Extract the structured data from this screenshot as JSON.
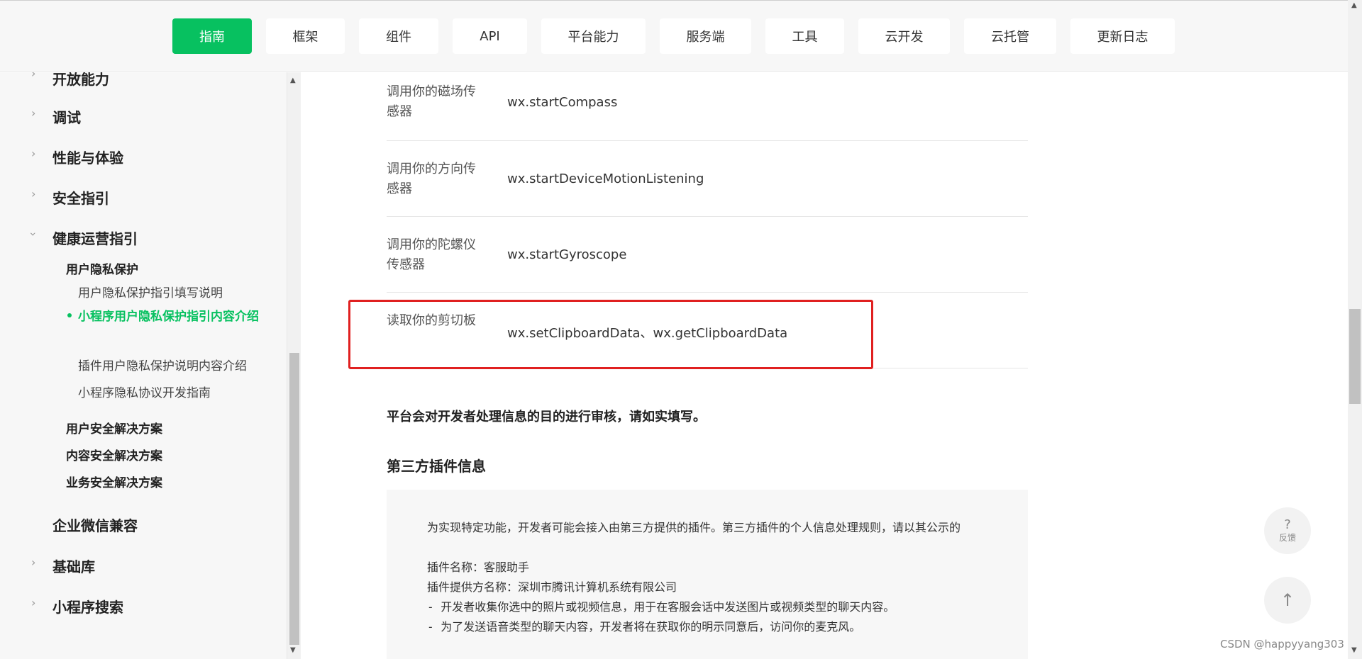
{
  "nav": {
    "tabs": [
      {
        "label": "指南",
        "active": true
      },
      {
        "label": "框架"
      },
      {
        "label": "组件"
      },
      {
        "label": "API"
      },
      {
        "label": "平台能力"
      },
      {
        "label": "服务端"
      },
      {
        "label": "工具"
      },
      {
        "label": "云开发"
      },
      {
        "label": "云托管"
      },
      {
        "label": "更新日志"
      }
    ]
  },
  "sidebar": {
    "top_partial": "开放能力",
    "items": [
      "调试",
      "性能与体验",
      "安全指引",
      "健康运营指引"
    ],
    "health": {
      "sub_head": "用户隐私保护",
      "children": [
        "用户隐私保护指引填写说明",
        "小程序用户隐私保护指引内容介绍",
        "插件用户隐私保护说明内容介绍",
        "小程序隐私协议开发指南"
      ],
      "other_heads": [
        "用户安全解决方案",
        "内容安全解决方案",
        "业务安全解决方案"
      ]
    },
    "bottom_items": [
      "企业微信兼容",
      "基础库",
      "小程序搜索"
    ]
  },
  "content": {
    "rows": [
      {
        "perm": "调用你的磁场传感器",
        "api": "wx.startCompass"
      },
      {
        "perm": "调用你的方向传感器",
        "api": "wx.startDeviceMotionListening"
      },
      {
        "perm": "调用你的陀螺仪传感器",
        "api": "wx.startGyroscope"
      },
      {
        "perm": "读取你的剪切板",
        "api": "wx.setClipboardData、wx.getClipboardData"
      }
    ],
    "note": "平台会对开发者处理信息的目的进行审核，请如实填写。",
    "section_title": "第三方插件信息",
    "plugin_lines": [
      "为实现特定功能，开发者可能会接入由第三方提供的插件。第三方插件的个人信息处理规则，请以其公示的",
      "插件名称：客服助手",
      "插件提供方名称：深圳市腾讯计算机系统有限公司",
      "- 开发者收集你选中的照片或视频信息，用于在客服会话中发送图片或视频类型的聊天内容。",
      "- 为了发送语音类型的聊天内容，开发者将在获取你的明示同意后，访问你的麦克风。"
    ]
  },
  "fab": {
    "feedback_symbol": "?",
    "feedback_label": "反馈",
    "top_symbol": "↑"
  },
  "watermark": "CSDN @happyyang303",
  "colors": {
    "accent": "#07c160",
    "highlight_border": "#e02020"
  }
}
